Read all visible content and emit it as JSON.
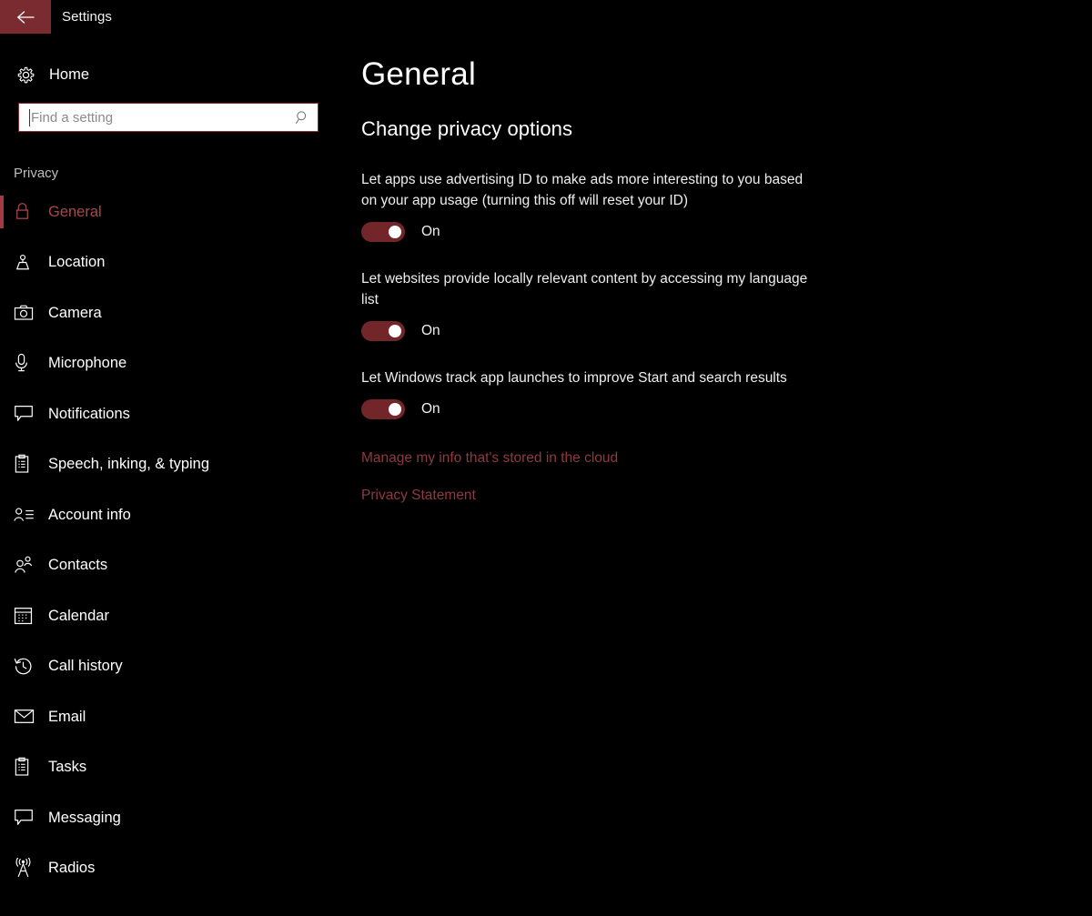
{
  "titlebar": {
    "back_icon": "arrow-left-icon",
    "title": "Settings",
    "accent_color": "#7a2b2f"
  },
  "sidebar": {
    "home": {
      "icon": "gear-icon",
      "label": "Home"
    },
    "search": {
      "icon": "search-icon",
      "placeholder": "Find a setting",
      "value": ""
    },
    "group_header": "Privacy",
    "selected_item": "General",
    "accent_color": "#a33a40",
    "items": [
      {
        "label": "General",
        "icon": "lock-icon",
        "selected": true
      },
      {
        "label": "Location",
        "icon": "location-icon",
        "selected": false
      },
      {
        "label": "Camera",
        "icon": "camera-icon",
        "selected": false
      },
      {
        "label": "Microphone",
        "icon": "microphone-icon",
        "selected": false
      },
      {
        "label": "Notifications",
        "icon": "speech-bubble-icon",
        "selected": false
      },
      {
        "label": "Speech, inking, & typing",
        "icon": "clipboard-icon",
        "selected": false
      },
      {
        "label": "Account info",
        "icon": "account-info-icon",
        "selected": false
      },
      {
        "label": "Contacts",
        "icon": "contacts-icon",
        "selected": false
      },
      {
        "label": "Calendar",
        "icon": "calendar-icon",
        "selected": false
      },
      {
        "label": "Call history",
        "icon": "call-history-icon",
        "selected": false
      },
      {
        "label": "Email",
        "icon": "envelope-icon",
        "selected": false
      },
      {
        "label": "Tasks",
        "icon": "clipboard-icon",
        "selected": false
      },
      {
        "label": "Messaging",
        "icon": "speech-bubble-icon",
        "selected": false
      },
      {
        "label": "Radios",
        "icon": "radio-tower-icon",
        "selected": false
      }
    ]
  },
  "main": {
    "page_title": "General",
    "section_title": "Change privacy options",
    "toggle_fill_color": "#72262a",
    "options": [
      {
        "text": "Let apps use advertising ID to make ads more interesting to you based on your app usage (turning this off will reset your ID)",
        "state_label": "On",
        "on": true
      },
      {
        "text": "Let websites provide locally relevant content by accessing my language list",
        "state_label": "On",
        "on": true
      },
      {
        "text": "Let Windows track app launches to improve Start and search results",
        "state_label": "On",
        "on": true
      }
    ],
    "links": [
      {
        "label": "Manage my info that's stored in the cloud"
      },
      {
        "label": "Privacy Statement"
      }
    ],
    "link_color": "#8d3a40"
  }
}
